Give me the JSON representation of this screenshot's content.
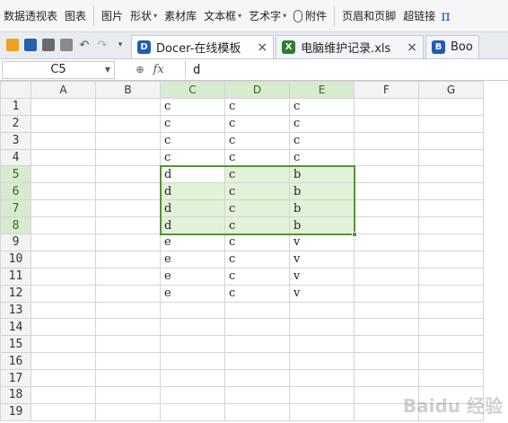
{
  "ribbon": {
    "items": [
      {
        "label": "数据透视表"
      },
      {
        "label": "图表"
      },
      {
        "label": "图片"
      },
      {
        "label": "形状",
        "caret": "▾"
      },
      {
        "label": "素材库"
      },
      {
        "label": "文本框",
        "caret": "▾"
      },
      {
        "label": "艺术字",
        "caret": "▾"
      },
      {
        "label": "附件"
      },
      {
        "label": "页眉和页脚"
      },
      {
        "label": "超链接"
      }
    ],
    "pi_glyph": "π"
  },
  "tabs": [
    {
      "label": "Docer-在线模板",
      "icon": "D",
      "icon_color": "#1e5bb8",
      "close": "×"
    },
    {
      "label": "电脑维护记录.xls",
      "icon": "X",
      "icon_color": "#2e7d32",
      "close": "×"
    },
    {
      "label": "Boo",
      "icon": "B",
      "icon_color": "#1e5bb8",
      "close": ""
    }
  ],
  "formula_bar": {
    "name_box": "C5",
    "fx_label": "fx",
    "zoom_glyph": "🔍",
    "value": "d"
  },
  "grid": {
    "columns": [
      "A",
      "B",
      "C",
      "D",
      "E",
      "F",
      "G"
    ],
    "selected_columns": [
      "C",
      "D",
      "E"
    ],
    "selected_rows": [
      5,
      6,
      7,
      8
    ],
    "rows": [
      {
        "n": "1",
        "cells": [
          "",
          "",
          "c",
          "c",
          "c",
          "",
          ""
        ]
      },
      {
        "n": "2",
        "cells": [
          "",
          "",
          "c",
          "c",
          "c",
          "",
          ""
        ]
      },
      {
        "n": "3",
        "cells": [
          "",
          "",
          "c",
          "c",
          "c",
          "",
          ""
        ]
      },
      {
        "n": "4",
        "cells": [
          "",
          "",
          "c",
          "c",
          "c",
          "",
          ""
        ]
      },
      {
        "n": "5",
        "cells": [
          "",
          "",
          "d",
          "c",
          "b",
          "",
          ""
        ]
      },
      {
        "n": "6",
        "cells": [
          "",
          "",
          "d",
          "c",
          "b",
          "",
          ""
        ]
      },
      {
        "n": "7",
        "cells": [
          "",
          "",
          "d",
          "c",
          "b",
          "",
          ""
        ]
      },
      {
        "n": "8",
        "cells": [
          "",
          "",
          "d",
          "c",
          "b",
          "",
          ""
        ]
      },
      {
        "n": "9",
        "cells": [
          "",
          "",
          "e",
          "c",
          "v",
          "",
          ""
        ]
      },
      {
        "n": "10",
        "cells": [
          "",
          "",
          "e",
          "c",
          "v",
          "",
          ""
        ]
      },
      {
        "n": "11",
        "cells": [
          "",
          "",
          "e",
          "c",
          "v",
          "",
          ""
        ]
      },
      {
        "n": "12",
        "cells": [
          "",
          "",
          "e",
          "c",
          "v",
          "",
          ""
        ]
      },
      {
        "n": "13",
        "cells": [
          "",
          "",
          "",
          "",
          "",
          "",
          ""
        ]
      },
      {
        "n": "14",
        "cells": [
          "",
          "",
          "",
          "",
          "",
          "",
          ""
        ]
      },
      {
        "n": "15",
        "cells": [
          "",
          "",
          "",
          "",
          "",
          "",
          ""
        ]
      },
      {
        "n": "16",
        "cells": [
          "",
          "",
          "",
          "",
          "",
          "",
          ""
        ]
      },
      {
        "n": "17",
        "cells": [
          "",
          "",
          "",
          "",
          "",
          "",
          ""
        ]
      },
      {
        "n": "18",
        "cells": [
          "",
          "",
          "",
          "",
          "",
          "",
          ""
        ]
      },
      {
        "n": "19",
        "cells": [
          "",
          "",
          "",
          "",
          "",
          "",
          ""
        ]
      }
    ]
  },
  "colors": {
    "selection_border": "#5a8f3c",
    "selection_fill": "#e2f2d8",
    "header_selected": "#d8ead0"
  },
  "watermark": "Baidu 经验"
}
